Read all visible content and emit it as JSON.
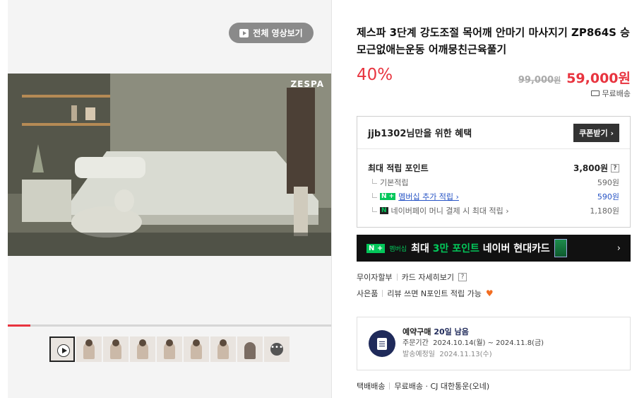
{
  "media": {
    "video_button_label": "전체 영상보기",
    "brand_watermark": "ZESPA",
    "progress_fraction": 0.07,
    "thumbnail_count": 9
  },
  "product": {
    "title": "제스파 3단계 강도조절 목어깨 안마기 마사지기 ZP864S 승모근없애는운동 어깨뭉친근육풀기",
    "discount": "40%",
    "original_price": "99,000",
    "original_won": "원",
    "price": "59,000원",
    "shipping": "무료배송"
  },
  "benefit": {
    "title": "jjb1302님만을 위한 혜택",
    "coupon_button": "쿠폰받기 ›",
    "max_points_label": "최대 적립 포인트",
    "max_points_value": "3,800원",
    "help": "?",
    "rows": [
      {
        "label": "기본적립",
        "value": "590원"
      },
      {
        "badge": "N +",
        "label": "멤버십 추가 적립 ›",
        "value": "590원"
      },
      {
        "badge": "N",
        "label": "네이버페이 머니 결제 시 최대 적립 ›",
        "value": "1,180원"
      }
    ]
  },
  "banner": {
    "badge": "N +",
    "membership": "멤버십",
    "text_prefix": "최대 ",
    "text_highlight": "3만 포인트",
    "text_suffix": " 네이버 현대카드",
    "arrow": "›"
  },
  "options": {
    "installment": "무이자할부",
    "card_detail": "카드 자세히보기",
    "help": "?",
    "gift_label": "사은품",
    "gift_text": "리뷰 쓰면 N포인트 적립 가능",
    "heart": "♥"
  },
  "reserve": {
    "title_prefix": "예약구매",
    "title_days": "20일 남음",
    "order_period_label": "주문기간",
    "order_period": "2024.10.14(월) ~ 2024.11.8(금)",
    "ship_date_label": "발송예정일",
    "ship_date": "2024.11.13(수)"
  },
  "delivery": {
    "method": "택배배송",
    "info": "무료배송 · CJ 대한통운(오네)"
  },
  "colors": {
    "accent_red": "#e8343f",
    "naver_green": "#03c75a",
    "reserve_navy": "#1f2a5a"
  }
}
